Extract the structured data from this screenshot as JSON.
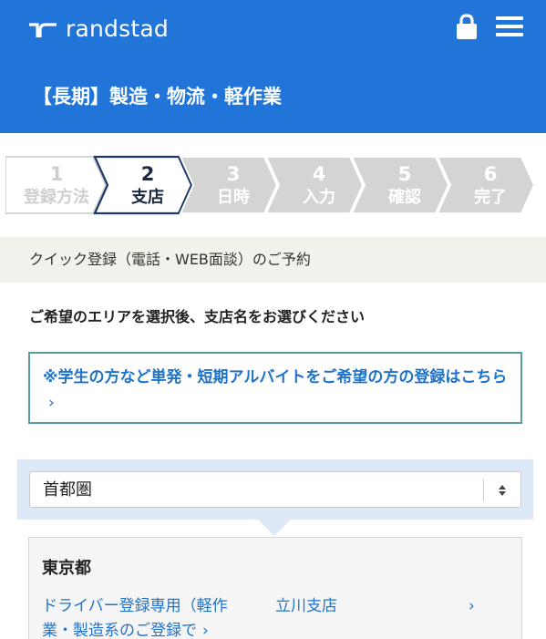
{
  "header": {
    "brand": "randstad",
    "job_category": "【長期】製造・物流・軽作業"
  },
  "steps": [
    {
      "number": "1",
      "label": "登録方法",
      "state": "done"
    },
    {
      "number": "2",
      "label": "支店",
      "state": "active"
    },
    {
      "number": "3",
      "label": "日時",
      "state": "upcoming"
    },
    {
      "number": "4",
      "label": "入力",
      "state": "upcoming"
    },
    {
      "number": "5",
      "label": "確認",
      "state": "upcoming"
    },
    {
      "number": "6",
      "label": "完了",
      "state": "upcoming"
    }
  ],
  "subheader": "クイック登録（電話・WEB面談）のご予約",
  "instruction": "ご希望のエリアを選択後、支店名をお選びください",
  "notice": {
    "text": "※学生の方など単発・短期アルバイトをご希望の方の登録はこちら",
    "chevron": "›"
  },
  "region_select": {
    "value": "首都圏"
  },
  "branch_list": {
    "prefecture": "東京都",
    "items": [
      {
        "label": "ドライバー登録専用（軽作業・製造系のご登録で",
        "chevron": "›"
      },
      {
        "label": "立川支店",
        "chevron": "›"
      }
    ]
  },
  "colors": {
    "brand_blue": "#2175d9",
    "link_blue": "#1f73c9",
    "step_active_border": "#1b3a6b",
    "step_inactive": "#d4d4d4",
    "notice_border": "#5a9aa2",
    "region_panel": "#dde9f7",
    "subhead_bg": "#f3f1ec"
  },
  "icons": {
    "logo": "randstad-logo-icon",
    "lock": "lock-icon",
    "menu": "hamburger-menu-icon",
    "select": "select-arrows-icon"
  }
}
